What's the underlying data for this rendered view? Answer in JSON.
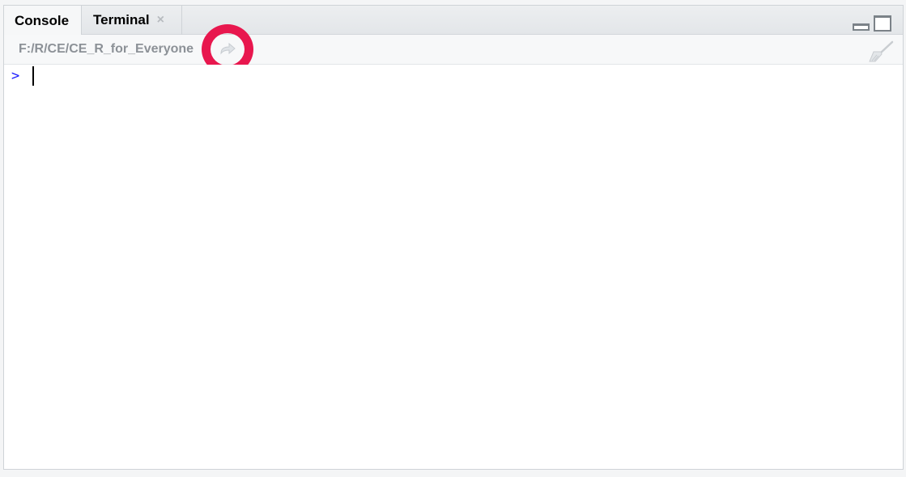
{
  "tabs": [
    {
      "label": "Console",
      "active": true
    },
    {
      "label": "Terminal",
      "active": false,
      "close_glyph": "×"
    }
  ],
  "pane_controls": {
    "minimize_icon": "minimize-pane-icon",
    "maximize_icon": "maximize-pane-icon"
  },
  "pathbar": {
    "path": "F:/R/CE/CE_R_for_Everyone",
    "goto_icon": "go-to-directory-arrow-icon",
    "clear_icon": "broom-icon"
  },
  "console": {
    "prompt": ">",
    "input": ""
  },
  "colors": {
    "prompt": "#1a1aff",
    "highlight": "#e8174e",
    "path_text": "#8c9197"
  }
}
